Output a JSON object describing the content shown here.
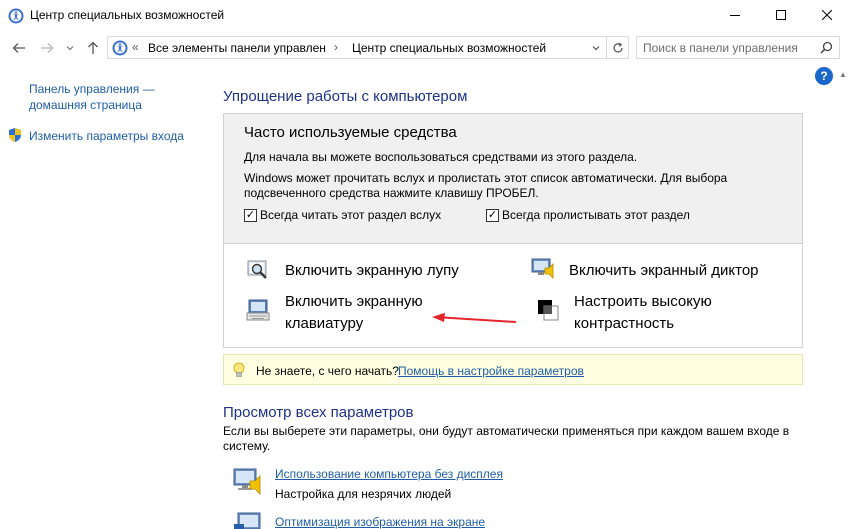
{
  "window": {
    "title": "Центр специальных возможностей"
  },
  "navigation": {
    "back_icon": "arrow-left-icon",
    "forward_icon": "arrow-right-icon",
    "up_icon": "arrow-up-icon",
    "breadcrumb_prefix": "«",
    "breadcrumb": [
      "Все элементы панели управлен",
      "Центр специальных возможностей"
    ],
    "breadcrumb_separator": "›"
  },
  "search": {
    "placeholder": "Поиск в панели управления"
  },
  "sidebar": {
    "home_link": "Панель управления — домашняя страница",
    "signin_link": "Изменить параметры входа"
  },
  "main": {
    "heading": "Упрощение работы с компьютером",
    "tools": {
      "title": "Часто используемые средства",
      "intro": "Для начала вы можете воспользоваться средствами из этого раздела.",
      "description": "Windows может прочитать вслух и пролистать этот список автоматически. Для выбора подсвеченного средства нажмите клавишу ПРОБЕЛ.",
      "check_read_aloud": {
        "label": "Всегда читать этот раздел вслух",
        "checked": true
      },
      "check_scan": {
        "label": "Всегда пролистывать этот раздел",
        "checked": true
      },
      "magnifier": "Включить экранную лупу",
      "narrator": "Включить экранный диктор",
      "keyboard_line1": "Включить экранную",
      "keyboard_line2": "клавиатуру",
      "contrast_line1": "Настроить высокую",
      "contrast_line2": "контрастность"
    },
    "tip": {
      "text": "Не знаете, с чего начать?",
      "link": "Помощь в настройке параметров"
    },
    "all_settings": {
      "heading": "Просмотр всех параметров",
      "description": "Если вы выберете эти параметры, они будут автоматически применяться при каждом вашем входе в систему.",
      "items": [
        {
          "link": "Использование компьютера без дисплея",
          "desc": "Настройка для незрячих людей"
        },
        {
          "link": "Оптимизация изображения на экране",
          "desc": ""
        }
      ]
    }
  },
  "colors": {
    "link": "#1e5ea8",
    "heading": "#1e3287",
    "tip_background": "#ffffe1",
    "arrow": "#e3262e"
  }
}
